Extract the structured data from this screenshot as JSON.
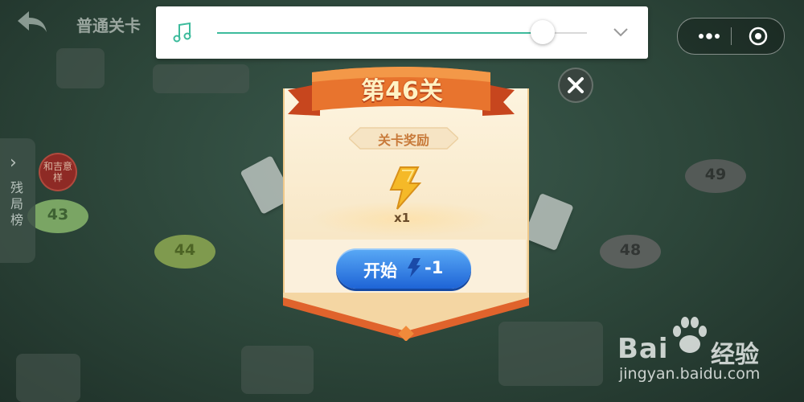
{
  "header": {
    "mode_title": "普通关卡"
  },
  "music": {
    "volume": 0.88
  },
  "side_tab": {
    "label": "残局榜"
  },
  "tag": {
    "text": "和吉意样"
  },
  "levels": [
    {
      "label": "43",
      "color": "#7aa564"
    },
    {
      "label": "44",
      "color": "#7f9a4e"
    },
    {
      "label": "48",
      "color": "#5a5f5c"
    },
    {
      "label": "49",
      "color": "#545a57"
    }
  ],
  "dialog": {
    "title": "第46关",
    "reward_label": "关卡奖励",
    "reward_icon": "lightning-bolt-icon",
    "reward_qty": "x1",
    "start_button": {
      "label": "开始",
      "cost": "-1"
    }
  },
  "watermark": {
    "brand": "Bai",
    "brand2": "经验",
    "url": "jingyan.baidu.com"
  },
  "colors": {
    "accent": "#3dbb9c",
    "ribbon": "#e46a2a",
    "button": "#2a74e0"
  }
}
